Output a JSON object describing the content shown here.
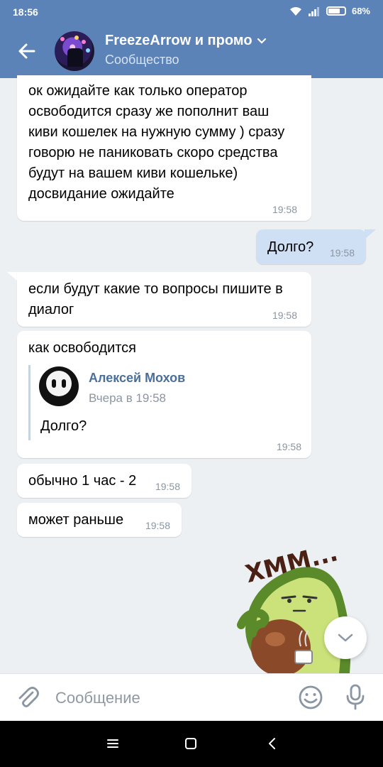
{
  "status_bar": {
    "time": "18:56",
    "battery": "68%"
  },
  "header": {
    "title": "FreezeArrow и промо",
    "subtitle": "Сообщество"
  },
  "messages": [
    {
      "text": "ок ожидайте как только оператор освободится сразу же пополнит ваш киви кошелек на нужную сумму ) сразу говорю не паниковать скоро средства будут на вашем киви кошельке) досвидание ожидайте",
      "time": "19:58"
    },
    {
      "text": "Долго?",
      "time": "19:58"
    },
    {
      "text": "если будут какие то вопросы пишите в диалог",
      "time": "19:58"
    },
    {
      "text": "как освободится",
      "time": "19:58",
      "reply": {
        "author": "Алексей Мохов",
        "date": "Вчера в 19:58",
        "text": "Долго?"
      }
    },
    {
      "text": "обычно 1 час - 2",
      "time": "19:58"
    },
    {
      "text": "может раньше",
      "time": "19:58"
    }
  ],
  "sticker": {
    "text": "ХММ..."
  },
  "compose": {
    "placeholder": "Сообщение"
  },
  "colors": {
    "header": "#5b83b8",
    "background": "#ecf0f3",
    "outgoing": "#cfe0f5",
    "link": "#4b6f99"
  },
  "icons": [
    "back-arrow-icon",
    "chevron-down-icon",
    "paperclip-icon",
    "smile-icon",
    "mic-icon",
    "menu-icon",
    "home-icon",
    "back-icon"
  ]
}
